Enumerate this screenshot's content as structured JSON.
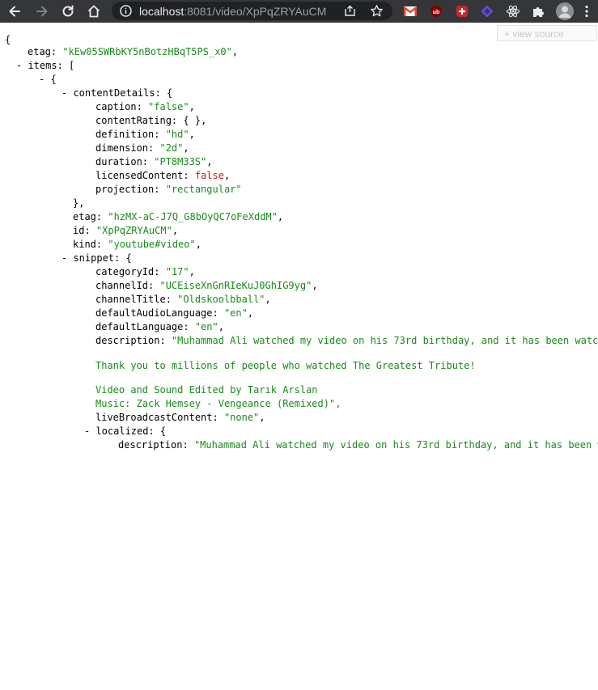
{
  "browser": {
    "url_host": "localhost",
    "url_rest": ":8081/video/XpPqZRYAuCM"
  },
  "viewer": {
    "view_source_label": "+ view source"
  },
  "json_lines": {
    "l0": "{",
    "etag_key": "etag",
    "etag_val": "\"kEw05SWRbKY5nBotzHBqT5PS_x0\"",
    "items_toggle": "- ",
    "items_key": "items",
    "items_open": ": [",
    "item_toggle": "- {",
    "cd_toggle": "- ",
    "cd_key": "contentDetails",
    "cd_open": ": {",
    "caption_key": "caption",
    "caption_val": "\"false\"",
    "contentRating_key": "contentRating",
    "contentRating_val": "{ }",
    "definition_key": "definition",
    "definition_val": "\"hd\"",
    "dimension_key": "dimension",
    "dimension_val": "\"2d\"",
    "duration_key": "duration",
    "duration_val": "\"PT8M33S\"",
    "licensed_key": "licensedContent",
    "licensed_val": "false",
    "projection_key": "projection",
    "projection_val": "\"rectangular\"",
    "cd_close": "},",
    "etag2_key": "etag",
    "etag2_val": "\"hzMX-aC-J7Q_G8bOyQC7oFeXddM\"",
    "id_key": "id",
    "id_val": "\"XpPqZRYAuCM\"",
    "kind_key": "kind",
    "kind_val": "\"youtube#video\"",
    "sn_toggle": "- ",
    "sn_key": "snippet",
    "sn_open": ": {",
    "categoryId_key": "categoryId",
    "categoryId_val": "\"17\"",
    "channelId_key": "channelId",
    "channelId_val": "\"UCEiseXnGnRIeKuJ0GhIG9yg\"",
    "channelTitle_key": "channelTitle",
    "channelTitle_val": "\"Oldskoolbball\"",
    "defaultAudio_key": "defaultAudioLanguage",
    "defaultAudio_val": "\"en\"",
    "defaultLang_key": "defaultLanguage",
    "defaultLang_val": "\"en\"",
    "desc_key": "description",
    "desc_val": "\"Muhammad Ali watched my video on his 73rd birthday, and it has been watc",
    "desc_line2": "Thank you to millions of people who watched The Greatest Tribute!",
    "desc_line3": "Video and Sound Edited by Tarık Arslan",
    "desc_line4": "Music: Zack Hemsey - Vengeance (Remixed)\",",
    "lbc_key": "liveBroadcastContent",
    "lbc_val": "\"none\"",
    "loc_toggle": "- ",
    "loc_key": "localized",
    "loc_open": ": {",
    "loc_desc_key": "description",
    "loc_desc_val": "\"Muhammad Ali watched my video on his 73rd birthday, and it has been w"
  }
}
